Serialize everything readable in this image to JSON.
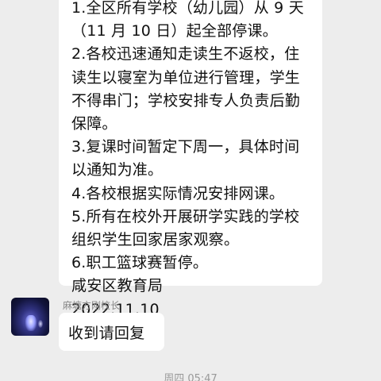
{
  "message": {
    "lines": [
      "1.全区所有学校（幼儿园）从 9 天",
      "（11 月 10 日）起全部停课。",
      "2.各校迅速通知走读生不返校，住",
      "读生以寝室为单位进行管理，学生",
      "不得串门；学校安排专人负责后勤",
      "保障。",
      "3.复课时间暂定下周一，具体时间",
      "以通知为准。",
      "4.各校根据实际情况安排网课。",
      "5.所有在校外开展研学实践的学校",
      "组织学生回家居家观察。",
      "6.职工篮球赛暂停。",
      "咸安区教育局",
      "2022.11.10"
    ]
  },
  "reply": {
    "sender": "麻塘方刚校长",
    "text": "收到请回复",
    "avatar_icon": "user-avatar"
  },
  "timestamp": "周四 05:47",
  "colors": {
    "background": "#ededed",
    "bubble": "#ffffff",
    "text": "#111111",
    "meta_text": "#888888"
  }
}
